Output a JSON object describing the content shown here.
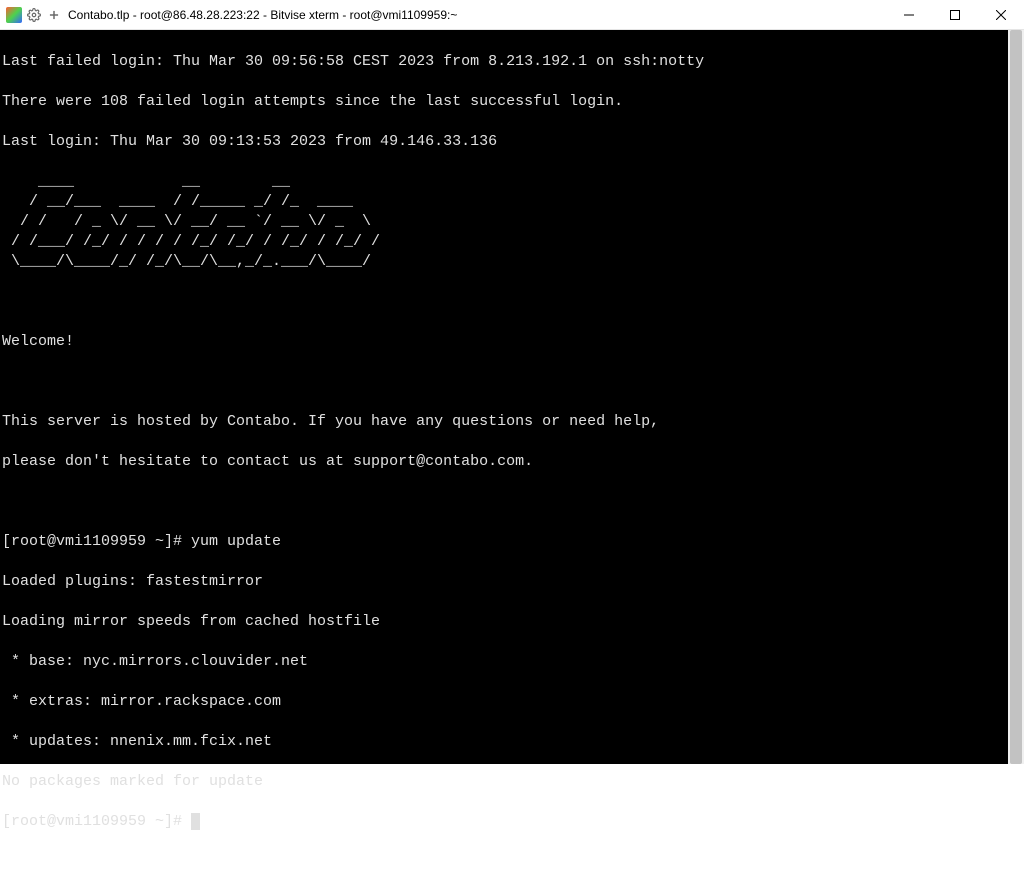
{
  "window": {
    "title": "Contabo.tlp - root@86.48.28.223:22 - Bitvise xterm - root@vmi1109959:~"
  },
  "terminal": {
    "login_failed": "Last failed login: Thu Mar 30 09:56:58 CEST 2023 from 8.213.192.1 on ssh:notty",
    "login_attempts": "There were 108 failed login attempts since the last successful login.",
    "last_login": "Last login: Thu Mar 30 09:13:53 2023 from 49.146.33.136",
    "ascii_art": "    ____            __        __          \n   / __/___  ____  / /_____ _/ /_  ____   \n  / /   / _ \\/ __ \\/ __/ __ `/ __ \\/ _  \\ \n / /___/ /_/ / / / / /_/ /_/ / /_/ / /_/ /\n \\____/\\____/_/ /_/\\__/\\__,_/_.___/\\____/ ",
    "welcome": "Welcome!",
    "hosted1": "This server is hosted by Contabo. If you have any questions or need help,",
    "hosted2": "please don't hesitate to contact us at support@contabo.com.",
    "prompt1": "[root@vmi1109959 ~]# yum update",
    "plugins": "Loaded plugins: fastestmirror",
    "loading": "Loading mirror speeds from cached hostfile",
    "mirror_base": " * base: nyc.mirrors.clouvider.net",
    "mirror_extras": " * extras: mirror.rackspace.com",
    "mirror_updates": " * updates: nnenix.mm.fcix.net",
    "no_packages": "No packages marked for update",
    "prompt2": "[root@vmi1109959 ~]# "
  }
}
